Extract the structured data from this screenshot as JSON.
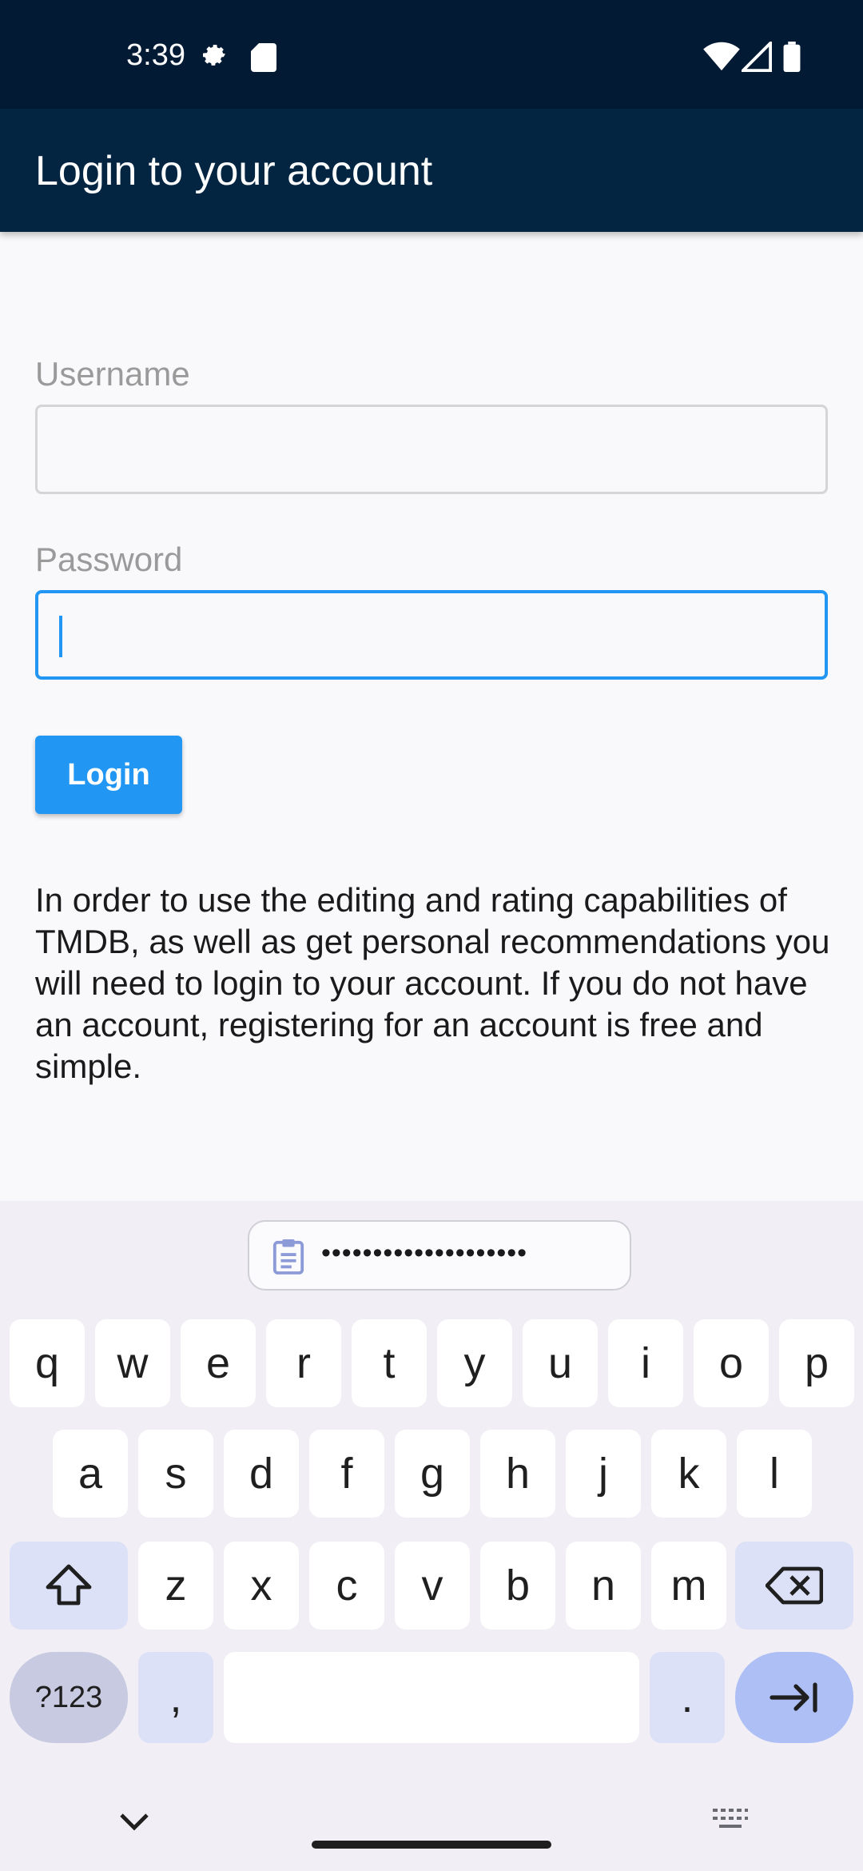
{
  "status_bar": {
    "time": "3:39",
    "icons": [
      "settings-gear-icon",
      "sd-card-icon",
      "wifi-icon",
      "signal-icon",
      "battery-icon"
    ]
  },
  "app_bar": {
    "title": "Login to your account",
    "color": "#032541"
  },
  "form": {
    "username": {
      "label": "Username",
      "value": ""
    },
    "password": {
      "label": "Password",
      "value": "",
      "focused": true
    },
    "login_button": "Login",
    "accent": "#2196f3"
  },
  "info": {
    "text": "In order to use the editing and rating capabilities of TMDB, as well as get personal recommendations you will need to login to your account. If you do not have an account, registering for an account is free and simple."
  },
  "keyboard": {
    "clipboard_suggestion": "••••••••••••••••••••",
    "row1": [
      "q",
      "w",
      "e",
      "r",
      "t",
      "y",
      "u",
      "i",
      "o",
      "p"
    ],
    "row2": [
      "a",
      "s",
      "d",
      "f",
      "g",
      "h",
      "j",
      "k",
      "l"
    ],
    "row3": [
      "z",
      "x",
      "c",
      "v",
      "b",
      "n",
      "m"
    ],
    "symbols_key": "?123",
    "comma_key": ",",
    "period_key": "."
  }
}
